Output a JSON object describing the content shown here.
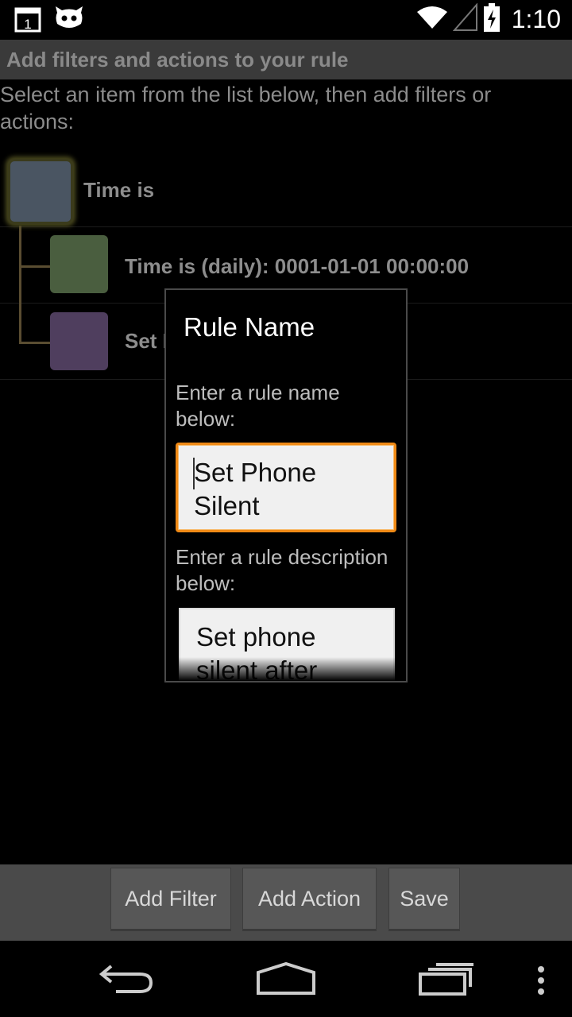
{
  "status_bar": {
    "time": "1:10",
    "calendar_day": "1",
    "icons": [
      "calendar-notification-icon",
      "cyanogen-mascot-icon",
      "wifi-icon",
      "cell-signal-icon",
      "battery-charging-icon"
    ]
  },
  "header": {
    "title": "Add filters and actions to your rule"
  },
  "instruction": "Select an item from the list below, then add filters or actions:",
  "tree": {
    "root": {
      "label": "Time is",
      "color": "#4a5562"
    },
    "children": [
      {
        "label": "Time is (daily): 0001-01-01 00:00:00",
        "color": "#4a5e3f"
      },
      {
        "label": "Set Phone Silent",
        "color": "#4f3e5e"
      }
    ]
  },
  "dialog": {
    "title": "Rule Name",
    "name_label": "Enter a rule name below:",
    "name_value": "Set Phone Silent",
    "description_label": "Enter a rule description below:",
    "description_value": "Set phone silent after"
  },
  "buttons": {
    "add_filter": "Add Filter",
    "add_action": "Add Action",
    "save": "Save"
  },
  "nav": {
    "icons": [
      "back-icon",
      "home-icon",
      "recent-apps-icon",
      "overflow-menu-icon"
    ]
  },
  "colors": {
    "accent": "#f08a16",
    "header_bg": "#3a3a3a",
    "button_bar_bg": "#4a4a4a"
  }
}
